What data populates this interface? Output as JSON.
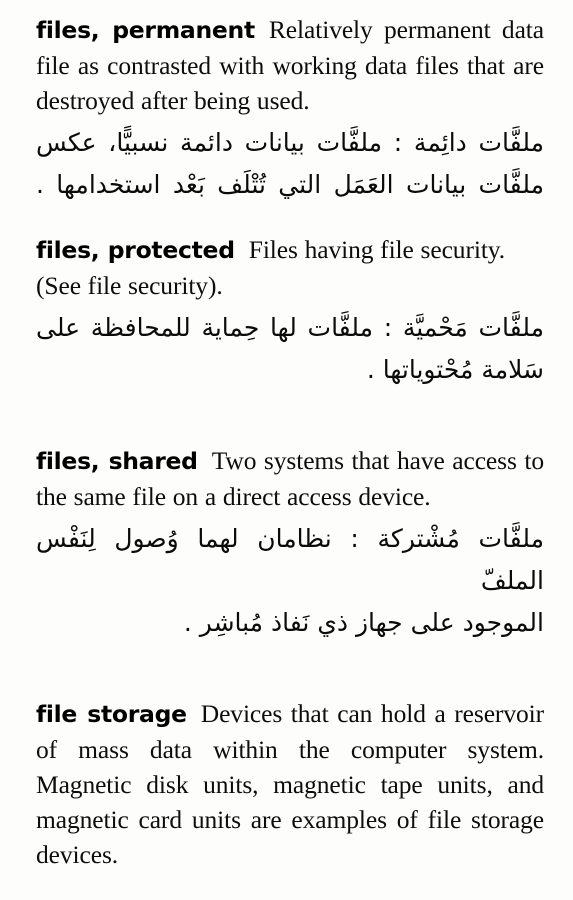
{
  "page": {
    "type": "dictionary-page",
    "language_pair": "English-Arabic",
    "background_color": "#fdfdfc",
    "text_color": "#0d0d0d"
  },
  "entries": [
    {
      "headword": "files, permanent",
      "definition": "Relatively permanent data file as contrasted with working data files that are destroyed after being used.",
      "arabic_lines": [
        "ملفَّات دائِمة : ملفَّات بيانات دائمة نسبيًّا، عكس",
        "ملفَّات بيانات العَمَل التي تُتْلَف بَعْد استخدامها ."
      ]
    },
    {
      "headword": "files, protected",
      "definition": "Files having file security. (See file security).",
      "arabic_lines": [
        "ملفَّات مَحْميَّة : ملفَّات لها حِماية للمحافظة على",
        "سَلامة مُحْتوياتها ."
      ]
    },
    {
      "headword": "files, shared",
      "definition": "Two systems that have access to the same file on a direct access device.",
      "arabic_lines": [
        "ملفَّات مُشْتركة : نظامان لهما وُصول لِنَفْس الملفّ",
        "الموجود على جهاز ذي نَفاذ مُباشِر ."
      ]
    },
    {
      "headword": "file storage",
      "definition": "Devices that can hold a reservoir of mass data within the computer system. Magnetic disk units, magnetic tape units, and magnetic card units are examples of file storage devices.",
      "arabic_lines": []
    }
  ]
}
